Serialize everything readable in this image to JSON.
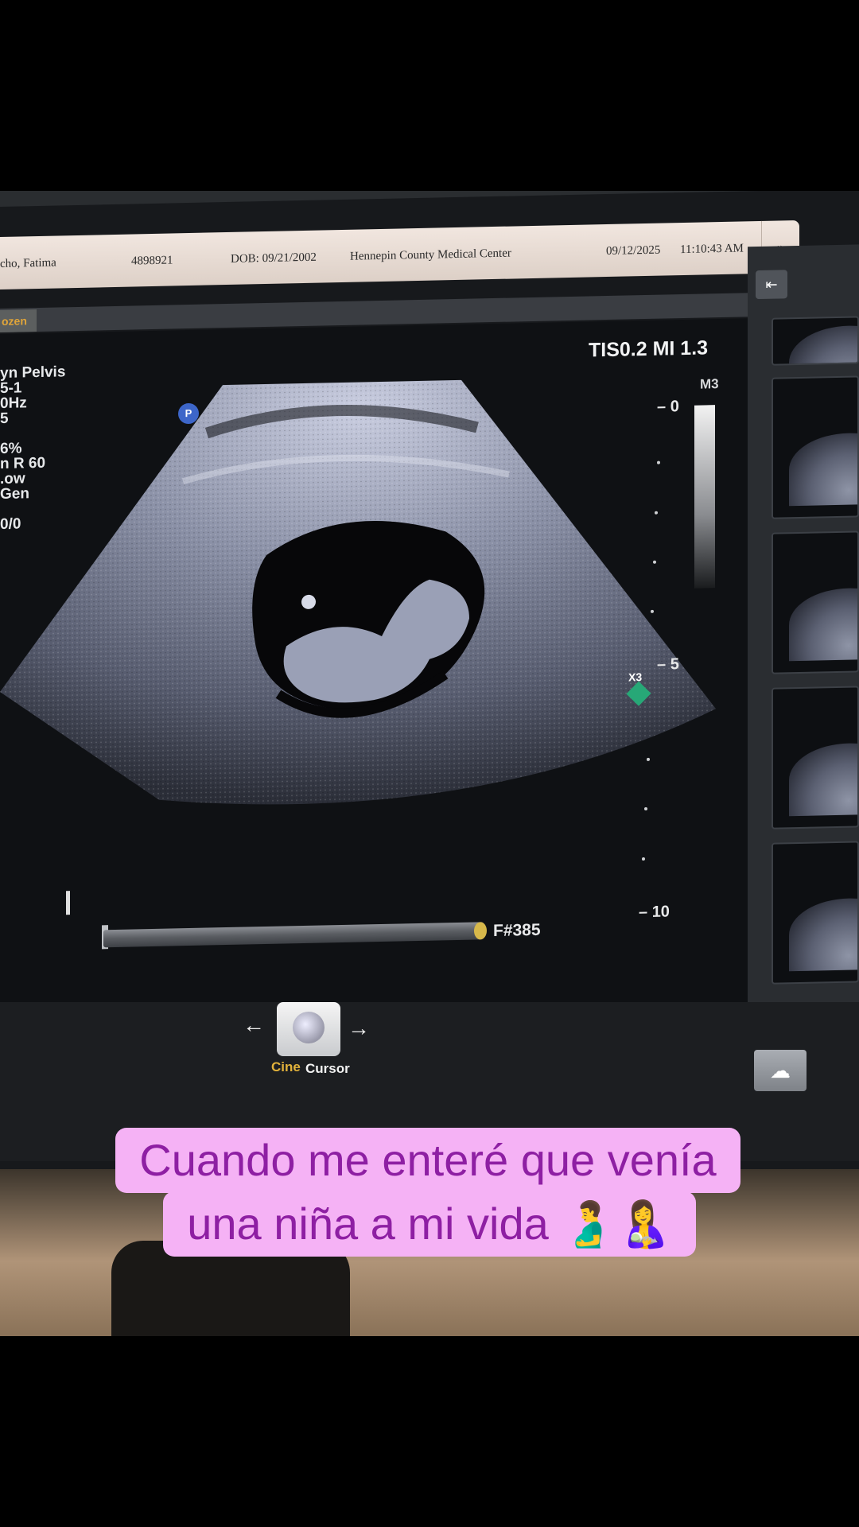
{
  "patient_bar": {
    "name": "cho, Fatima",
    "id": "4898921",
    "dob": "DOB: 09/21/2002",
    "center": "Hennepin County Medical Center",
    "date": "09/12/2025",
    "time": "11:10:43 AM",
    "chevron": "»"
  },
  "status": {
    "frozen": "ozen"
  },
  "params": [
    "yn Pelvis",
    "5-1",
    "0Hz",
    "5",
    "",
    "6%",
    "n R 60",
    ".ow",
    "Gen",
    "",
    "0/0"
  ],
  "acoustic": {
    "tis_mi": "TIS0.2  MI 1.3",
    "map": "M3",
    "probe": "P"
  },
  "depth_scale": {
    "d0": "0",
    "d5": "5",
    "d10": "10"
  },
  "marker": {
    "label": "X3"
  },
  "cine": {
    "frame": "F#385"
  },
  "controls": {
    "arrow_left": "←",
    "arrow_right": "→",
    "cine_label": "Cine",
    "cursor_label": "Cursor",
    "cloud_icon": "☁"
  },
  "caption": {
    "line1": "Cuando me enteré que venía",
    "line2": "una niña a mi vida 🫃🤱"
  }
}
